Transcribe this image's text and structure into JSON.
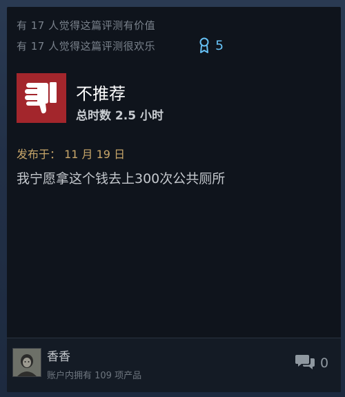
{
  "review": {
    "helpful_line": "有 17 人觉得这篇评测有价值",
    "funny_line": "有 17 人觉得这篇评测很欢乐",
    "award_count": "5",
    "verdict": "不推荐",
    "hours_on_record": "总时数 2.5 小时",
    "posted_date": "发布于：  11 月 19 日",
    "text": "我宁愿拿这个钱去上300次公共厕所"
  },
  "author": {
    "name": "香香",
    "products_owned": "账户内拥有 109 项产品"
  },
  "comments": {
    "count": "0"
  },
  "colors": {
    "thumb_bg": "#a3262c",
    "award_blue": "#66c0f4",
    "posted_gold": "#c9a76a"
  },
  "icons": {
    "award": "award-ribbon-icon",
    "thumb": "thumbs-down-icon",
    "comment": "comment-bubbles-icon"
  }
}
